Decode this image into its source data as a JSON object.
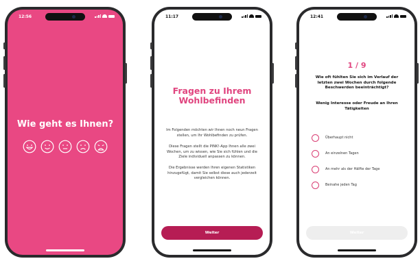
{
  "colors": {
    "brand_pink": "#e94883",
    "title_pink": "#e0457f",
    "button_dark": "#b61d54",
    "button_disabled": "#eeeeee",
    "phone_frame": "#2a2a2c"
  },
  "screen1": {
    "time": "12:56",
    "question": "Wie geht es Ihnen?",
    "faces": [
      "very-happy-face-icon",
      "happy-face-icon",
      "neutral-face-icon",
      "sad-face-icon",
      "very-sad-face-icon"
    ]
  },
  "screen2": {
    "time": "11:17",
    "title_line1": "Fragen zu Ihrem",
    "title_line2": "Wohlbefinden",
    "paragraph1": "Im Folgenden möchten wir Ihnen noch neun Fragen stellen, um Ihr Wohlbefinden zu prüfen.",
    "paragraph2": "Diese Fragen stellt die PINK!-App Ihnen alle zwei Wochen, um zu wissen, wie Sie sich fühlen und die Ziele individuell anpassen zu können.",
    "paragraph3": "Die Ergebnisse werden Ihren eigenen Statistiken hinzugefügt, damit Sie selbst diese auch jederzeit vergleichen können.",
    "button": "Weiter"
  },
  "screen3": {
    "time": "12:41",
    "progress": "1 / 9",
    "question": "Wie oft fühlten Sie sich im Verlauf der letzten zwei Wochen durch folgende Beschwerden beeinträchtigt?",
    "subquestion": "Wenig Interesse oder Freude an Ihren Tätigkeiten",
    "options": [
      "Überhaupt nicht",
      "An einzelnen Tagen",
      "An mehr als der Hälfte der Tage",
      "Beinahe jeden Tag"
    ],
    "button": "Weiter"
  }
}
